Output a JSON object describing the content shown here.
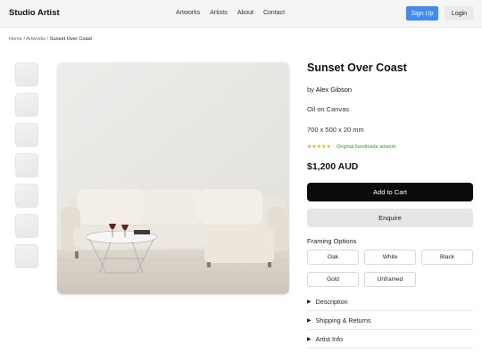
{
  "header": {
    "brand": "Studio Artist",
    "nav": [
      "Artworks",
      "Artists",
      "About",
      "Contact"
    ],
    "signup_label": "Sign Up",
    "login_label": "Login"
  },
  "breadcrumb": {
    "home": "Home",
    "sep1": " / ",
    "section": "Artworks",
    "sep2": " / ",
    "current": "Sunset Over Coast"
  },
  "gallery": {
    "thumbnail_count": 7
  },
  "product": {
    "title": "Sunset Over Coast",
    "artist_prefix": "by ",
    "artist": "Alex Gibson",
    "medium": "Oil on Canvas",
    "dimensions": "700 x 500 x 20 mm",
    "stars": "★★★★★",
    "rating_note": "Original handmade artwork",
    "price": "$1,200 AUD",
    "add_to_cart_label": "Add to Cart",
    "enquire_label": "Enquire"
  },
  "framing": {
    "label": "Framing Options",
    "options": [
      "Oak",
      "White",
      "Black",
      "Gold",
      "Unframed"
    ]
  },
  "accordion": {
    "sections": [
      "Description",
      "Shipping & Returns",
      "Artist Info"
    ],
    "icon": "triangle-right-icon"
  },
  "colors": {
    "accent": "#3d8bfd",
    "cart_button": "#0b0b0b",
    "rating_star": "#e0a800",
    "rating_note": "#2e9a3a"
  }
}
